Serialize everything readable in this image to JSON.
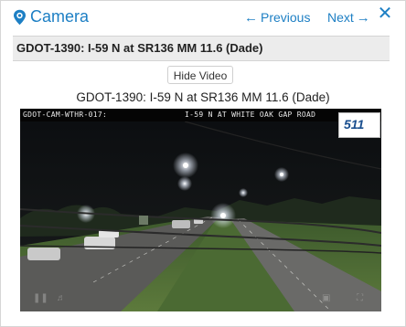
{
  "header": {
    "title": "Camera",
    "previous_label": "Previous",
    "next_label": "Next",
    "close_symbol": "✕"
  },
  "camera_title": "GDOT-1390: I-59 N at SR136 MM 11.6 (Dade)",
  "hide_video_label": "Hide Video",
  "video": {
    "caption": "GDOT-1390: I-59 N at SR136 MM 11.6 (Dade)",
    "overlay_left": "GDOT-CAM-WTHR-017:",
    "overlay_right": "I-59 N AT WHITE OAK GAP ROAD",
    "logo_text": "511"
  },
  "icons": {
    "pin": "map-pin-icon",
    "previous": "arrow-left-icon",
    "next": "arrow-right-icon",
    "close": "close-icon"
  },
  "colors": {
    "accent": "#1d7fc4",
    "title_bar_bg": "#ececec"
  }
}
